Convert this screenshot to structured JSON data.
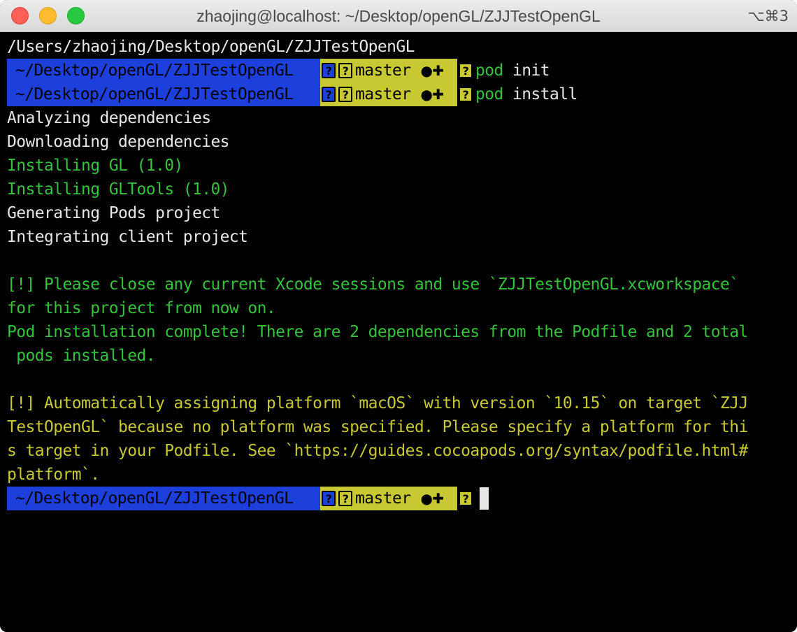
{
  "window": {
    "title": "zhaojing@localhost: ~/Desktop/openGL/ZJJTestOpenGL",
    "shortcut": "⌥⌘3"
  },
  "terminal": {
    "cwd_line": "/Users/zhaojing/Desktop/openGL/ZJJTestOpenGL",
    "prompt": {
      "path": "~/Desktop/openGL/ZJJTestOpenGL",
      "branch": "master",
      "status": "●✚",
      "unknown_glyph": "?"
    },
    "commands": [
      {
        "name": "pod",
        "arg": " init"
      },
      {
        "name": "pod",
        "arg": " install"
      }
    ],
    "output": [
      {
        "text": "Analyzing dependencies",
        "color": "white"
      },
      {
        "text": "Downloading dependencies",
        "color": "white"
      },
      {
        "text": "Installing GL (1.0)",
        "color": "green"
      },
      {
        "text": "Installing GLTools (1.0)",
        "color": "green"
      },
      {
        "text": "Generating Pods project",
        "color": "white"
      },
      {
        "text": "Integrating client project",
        "color": "white"
      },
      {
        "text": "",
        "color": "white"
      },
      {
        "text": "[!] Please close any current Xcode sessions and use `ZJJTestOpenGL.xcworkspace`",
        "color": "green"
      },
      {
        "text": "for this project from now on.",
        "color": "green"
      },
      {
        "text": "Pod installation complete! There are 2 dependencies from the Podfile and 2 total",
        "color": "green"
      },
      {
        "text": " pods installed.",
        "color": "green"
      },
      {
        "text": "",
        "color": "white"
      },
      {
        "text": "[!] Automatically assigning platform `macOS` with version `10.15` on target `ZJJ",
        "color": "yellow"
      },
      {
        "text": "TestOpenGL` because no platform was specified. Please specify a platform for thi",
        "color": "yellow"
      },
      {
        "text": "s target in your Podfile. See `https://guides.cocoapods.org/syntax/podfile.html#",
        "color": "yellow"
      },
      {
        "text": "platform`.",
        "color": "yellow"
      }
    ]
  },
  "colors": {
    "prompt_path_bg": "#1d3fdc",
    "prompt_git_bg": "#c8c832",
    "green_text": "#35c23d",
    "yellow_text": "#c8c832",
    "white_text": "#e6e6e6"
  }
}
